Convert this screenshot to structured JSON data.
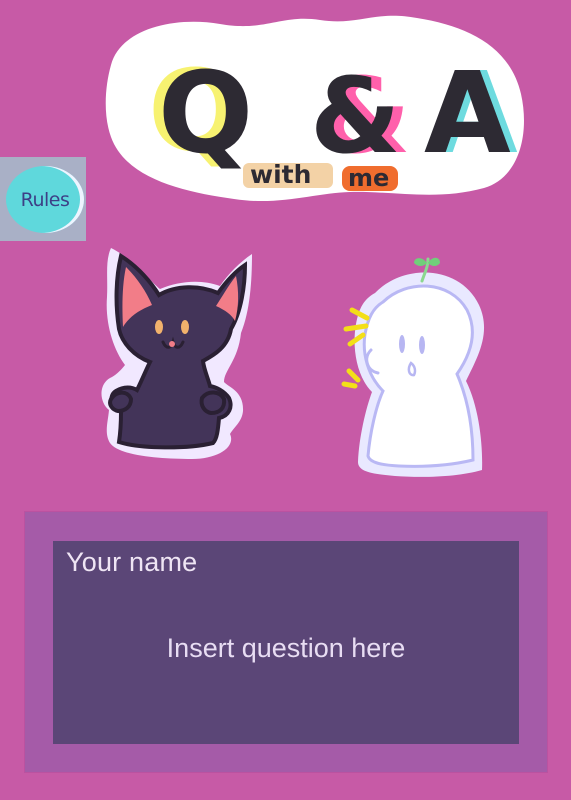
{
  "banner": {
    "title": "Q&A",
    "subtitle_with": "with",
    "subtitle_me": "me"
  },
  "rules": {
    "label": "Rules"
  },
  "form": {
    "name_placeholder": "Your name",
    "question_placeholder": "Insert question here"
  },
  "colors": {
    "background": "#c75aa6",
    "panel": "#a55ba8",
    "card": "#5b4677",
    "accent_cyan": "#5fd8dc",
    "accent_pink": "#ff4fa3",
    "accent_yellow": "#f7f26a"
  },
  "icons": {
    "rules_icon": "circle-badge",
    "cat_character": "cat-icon",
    "ghost_character": "ghost-icon"
  }
}
